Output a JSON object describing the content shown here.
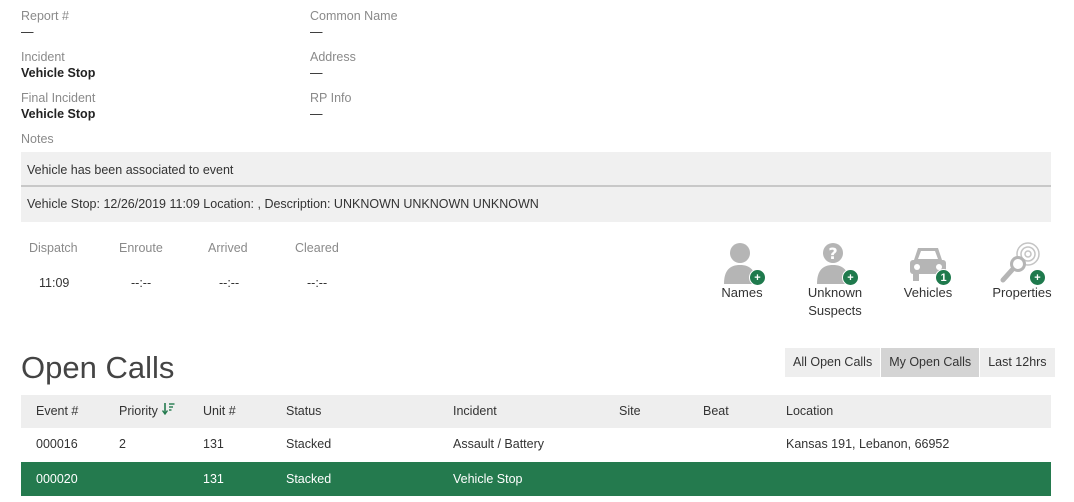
{
  "details": {
    "report_label": "Report #",
    "report_value": "—",
    "common_name_label": "Common Name",
    "common_name_value": "—",
    "incident_label": "Incident",
    "incident_value": "Vehicle Stop",
    "address_label": "Address",
    "address_value": "—",
    "final_incident_label": "Final Incident",
    "final_incident_value": "Vehicle Stop",
    "rp_info_label": "RP Info",
    "rp_info_value": "—",
    "notes_label": "Notes"
  },
  "notes": [
    "Vehicle has been associated to event",
    "Vehicle Stop: 12/26/2019 11:09 Location: , Description: UNKNOWN UNKNOWN UNKNOWN"
  ],
  "times": {
    "dispatch_label": "Dispatch",
    "dispatch_value": "11:09",
    "enroute_label": "Enroute",
    "enroute_value": "--:--",
    "arrived_label": "Arrived",
    "arrived_value": "--:--",
    "cleared_label": "Cleared",
    "cleared_value": "--:--"
  },
  "associations": [
    {
      "label": "Names",
      "badge": "+",
      "icon": "person-icon"
    },
    {
      "label": "Unknown Suspects",
      "badge": "+",
      "icon": "unknown-person-icon"
    },
    {
      "label": "Vehicles",
      "badge": "1",
      "icon": "car-icon"
    },
    {
      "label": "Properties",
      "badge": "+",
      "icon": "fingerprint-search-icon"
    }
  ],
  "open_calls": {
    "title": "Open Calls",
    "filters": [
      "All Open Calls",
      "My Open Calls",
      "Last 12hrs"
    ],
    "active_filter": "My Open Calls",
    "columns": [
      "Event #",
      "Priority",
      "Unit #",
      "Status",
      "Incident",
      "Site",
      "Beat",
      "Location"
    ],
    "rows": [
      {
        "event": "000016",
        "priority": "2",
        "unit": "131",
        "status": "Stacked",
        "incident": "Assault / Battery",
        "site": "",
        "beat": "",
        "location": "Kansas 191, Lebanon, 66952",
        "selected": false
      },
      {
        "event": "000020",
        "priority": "",
        "unit": "131",
        "status": "Stacked",
        "incident": "Vehicle Stop",
        "site": "",
        "beat": "",
        "location": "",
        "selected": true
      }
    ]
  },
  "colors": {
    "accent_green": "#247a4e",
    "badge_green": "#1f7a4d",
    "header_gray": "#eeeeee",
    "icon_gray": "#b5b5b5"
  }
}
